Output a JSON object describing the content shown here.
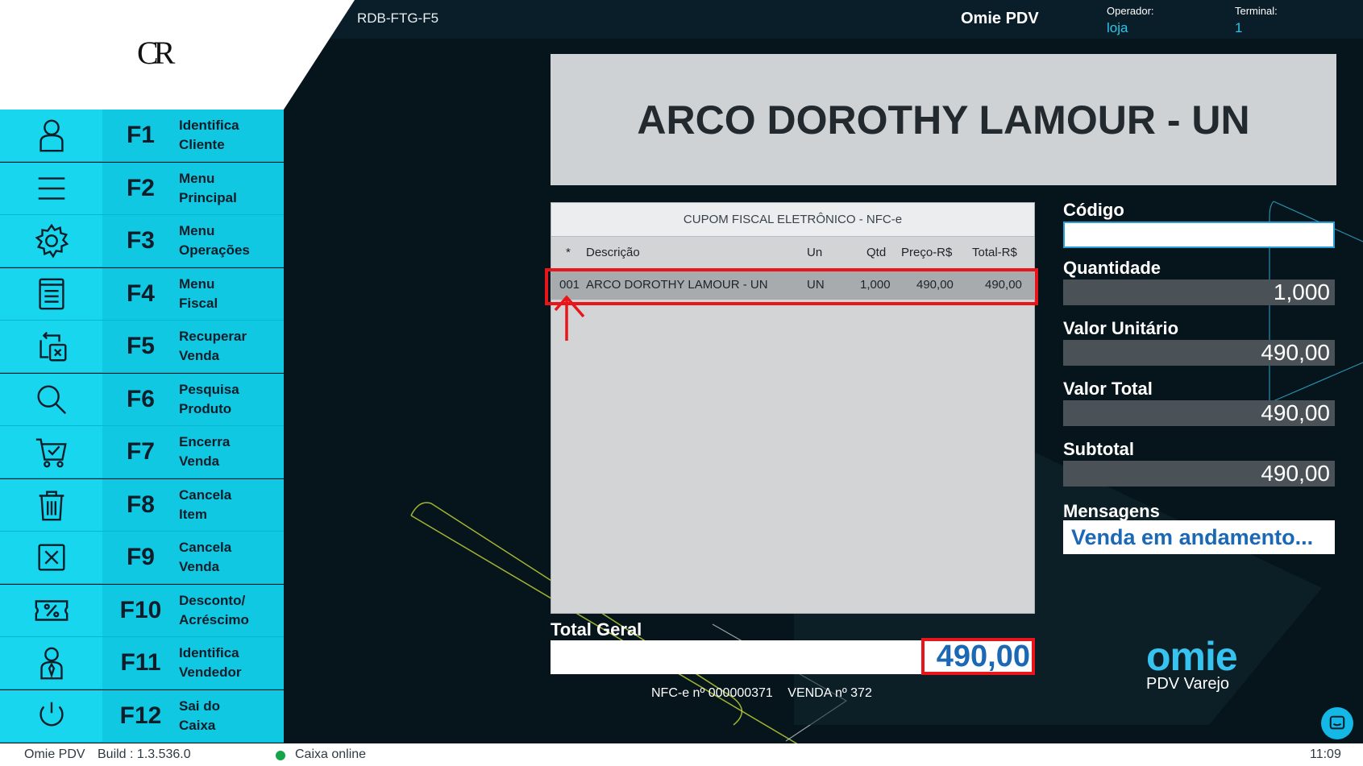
{
  "header": {
    "logo_text": "CR",
    "store_code": "RDB-FTG-F5",
    "app_title": "Omie PDV",
    "operator_label": "Operador:",
    "operator_value": "loja",
    "terminal_label": "Terminal:",
    "terminal_value": "1"
  },
  "sidebar": {
    "items": [
      {
        "key": "F1",
        "label": "Identifica\nCliente",
        "icon": "user-icon"
      },
      {
        "key": "F2",
        "label": "Menu\nPrincipal",
        "icon": "menu-icon"
      },
      {
        "key": "F3",
        "label": "Menu\nOperações",
        "icon": "gear-icon"
      },
      {
        "key": "F4",
        "label": "Menu\nFiscal",
        "icon": "receipt-icon"
      },
      {
        "key": "F5",
        "label": "Recuperar\nVenda",
        "icon": "recover-icon"
      },
      {
        "key": "F6",
        "label": "Pesquisa\nProduto",
        "icon": "search-icon"
      },
      {
        "key": "F7",
        "label": "Encerra\nVenda",
        "icon": "cart-check-icon"
      },
      {
        "key": "F8",
        "label": "Cancela\nItem",
        "icon": "trash-icon"
      },
      {
        "key": "F9",
        "label": "Cancela\nVenda",
        "icon": "cancel-box-icon"
      },
      {
        "key": "F10",
        "label": "Desconto/\nAcréscimo",
        "icon": "percent-ticket-icon"
      },
      {
        "key": "F11",
        "label": "Identifica\nVendedor",
        "icon": "seller-icon"
      },
      {
        "key": "F12",
        "label": "Sai do\nCaixa",
        "icon": "power-icon"
      }
    ]
  },
  "product_banner": "ARCO DOROTHY LAMOUR - UN",
  "coupon": {
    "title": "CUPOM FISCAL ELETRÔNICO - NFC-e",
    "columns": [
      "*",
      "Descrição",
      "Un",
      "Qtd",
      "Preço-R$",
      "Total-R$"
    ],
    "rows": [
      [
        "001",
        "ARCO DOROTHY LAMOUR - UN",
        "UN",
        "1,000",
        "490,00",
        "490,00"
      ]
    ]
  },
  "total": {
    "label": "Total Geral",
    "value": "490,00"
  },
  "nfce": {
    "number": "NFC-e nº 000000371",
    "sale": "VENDA nº 372"
  },
  "fields": {
    "codigo_label": "Código",
    "codigo_value": "",
    "quantidade_label": "Quantidade",
    "quantidade_value": "1,000",
    "valor_unitario_label": "Valor Unitário",
    "valor_unitario_value": "490,00",
    "valor_total_label": "Valor Total",
    "valor_total_value": "490,00",
    "subtotal_label": "Subtotal",
    "subtotal_value": "490,00",
    "mensagens_label": "Mensagens",
    "mensagens_value": "Venda em andamento..."
  },
  "brand": {
    "name": "omie",
    "subtitle": "PDV Varejo"
  },
  "statusbar": {
    "app": "Omie PDV",
    "build": "Build : 1.3.536.0",
    "status": "Caixa online",
    "time": "11:09"
  },
  "colors": {
    "accent": "#10c8e2",
    "highlight": "#e8161b",
    "value_blue": "#1b68b4",
    "online": "#16a34a"
  }
}
